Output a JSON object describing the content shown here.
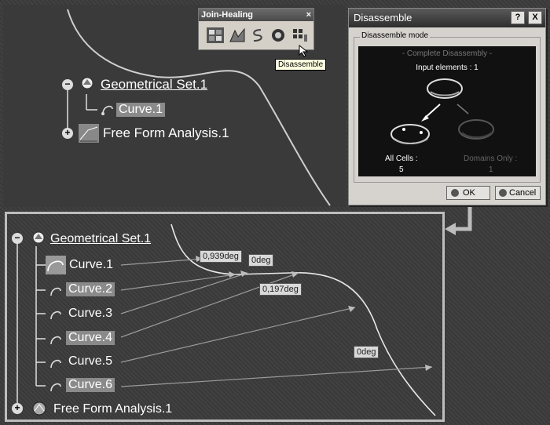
{
  "toolbar": {
    "title": "Join-Healing",
    "close_glyph": "×",
    "icons": [
      "join-icon",
      "healing-icon",
      "curve-smooth-icon",
      "untrim-icon",
      "disassemble-icon"
    ],
    "tooltip": "Disassemble"
  },
  "dialog": {
    "title": "Disassemble",
    "help_glyph": "?",
    "close_glyph": "X",
    "group_label": "Disassemble mode",
    "mode_label": "- Complete Disassembly -",
    "input_label": "Input elements : 1",
    "all_cells_label": "All Cells :",
    "all_cells_value": "5",
    "domains_label": "Domains Only :",
    "domains_value": "1",
    "ok_label": "OK",
    "cancel_label": "Cancel"
  },
  "top_tree": {
    "root_label": "Geometrical Set.1",
    "child_label": "Curve.1",
    "analysis_label": "Free Form Analysis.1"
  },
  "bottom_tree": {
    "root_label": "Geometrical Set.1",
    "curves": [
      "Curve.1",
      "Curve.2",
      "Curve.3",
      "Curve.4",
      "Curve.5",
      "Curve.6"
    ],
    "analysis_label": "Free Form Analysis.1"
  },
  "annotations": {
    "a1": "0,939deg",
    "a2": "0deg",
    "a3": "0,197deg",
    "a4": "0deg"
  }
}
